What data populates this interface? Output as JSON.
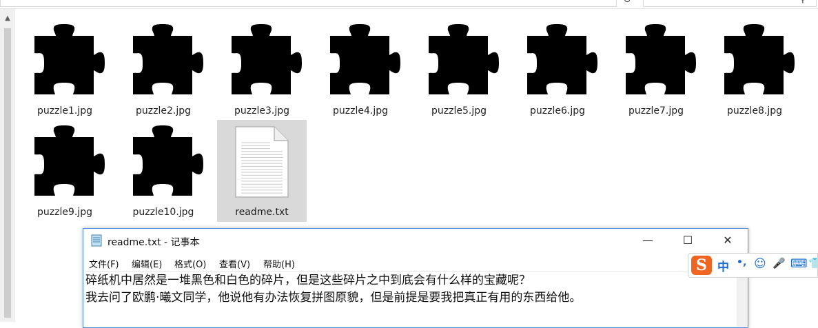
{
  "explorer": {
    "address_text": "",
    "search_placeholder": "",
    "files": [
      {
        "name": "puzzle1.jpg",
        "type": "image"
      },
      {
        "name": "puzzle2.jpg",
        "type": "image"
      },
      {
        "name": "puzzle3.jpg",
        "type": "image"
      },
      {
        "name": "puzzle4.jpg",
        "type": "image"
      },
      {
        "name": "puzzle5.jpg",
        "type": "image"
      },
      {
        "name": "puzzle6.jpg",
        "type": "image"
      },
      {
        "name": "puzzle7.jpg",
        "type": "image"
      },
      {
        "name": "puzzle8.jpg",
        "type": "image"
      },
      {
        "name": "puzzle9.jpg",
        "type": "image"
      },
      {
        "name": "puzzle10.jpg",
        "type": "image"
      },
      {
        "name": "readme.txt",
        "type": "text",
        "selected": true
      }
    ]
  },
  "notepad": {
    "title": "readme.txt - 记事本",
    "menu": [
      "文件(F)",
      "编辑(E)",
      "格式(O)",
      "查看(V)",
      "帮助(H)"
    ],
    "lines": [
      "碎纸机中居然是一堆黑色和白色的碎片，但是这些碎片之中到底会有什么样的宝藏呢？",
      "我去问了欧鹏·曦文同学，他说他有办法恢复拼图原貌，但是前提是要我把真正有用的东西给他。"
    ],
    "controls": {
      "minimize": "—",
      "maximize": "☐",
      "close": "✕"
    }
  },
  "ime": {
    "logo": "S",
    "items": [
      "中",
      "•,",
      "☺",
      "🎤",
      "⌨",
      "👕"
    ]
  },
  "colors": {
    "accent": "#4a90d9",
    "selection": "#d9d9d9",
    "ime_logo": "#f06522",
    "ime_icons": "#1f6fd2"
  }
}
